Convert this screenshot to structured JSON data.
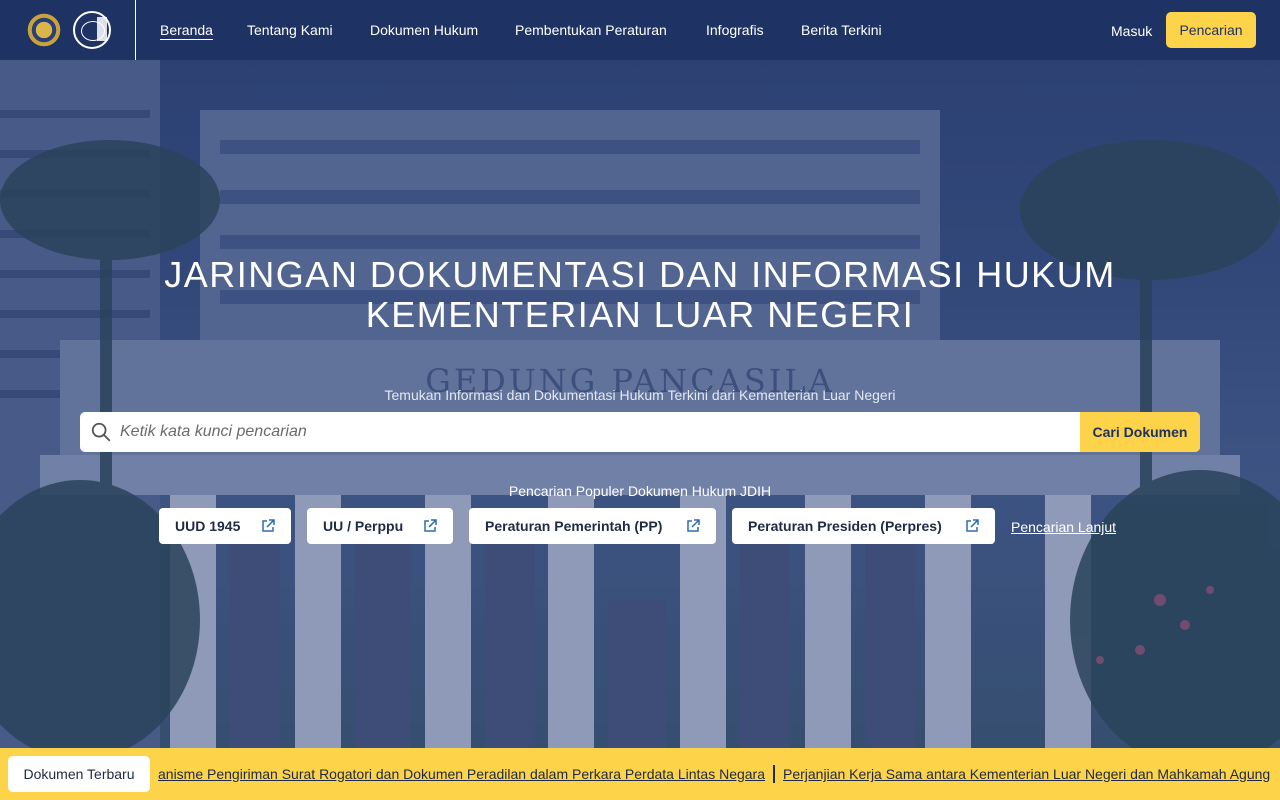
{
  "header": {
    "nav": [
      "Beranda",
      "Tentang Kami",
      "Dokumen Hukum",
      "Pembentukan Peraturan",
      "Infografis",
      "Berita Terkini"
    ],
    "active_nav": "Beranda",
    "login_label": "Masuk",
    "search_button_label": "Pencarian"
  },
  "hero": {
    "title_line1": "JARINGAN DOKUMENTASI DAN INFORMASI HUKUM",
    "title_line2": "KEMENTERIAN LUAR NEGERI",
    "subtitle": "Temukan Informasi dan Dokumentasi Hukum Terkini dari Kementerian Luar Negeri",
    "building_text": "GEDUNG PANCASILA"
  },
  "search": {
    "placeholder": "Ketik kata kunci pencarian",
    "value": "",
    "button_label": "Cari Dokumen"
  },
  "popular": {
    "label": "Pencarian Populer Dokumen Hukum JDIH",
    "items": [
      "UUD 1945",
      "UU / Perppu",
      "Peraturan Pemerintah (PP)",
      "Peraturan Presiden (Perpres)"
    ],
    "advanced_link": "Pencarian Lanjut"
  },
  "ticker": {
    "badge": "Dokumen Terbaru",
    "items": [
      "anisme Pengiriman Surat Rogatori dan Dokumen Peradilan dalam Perkara Perdata Lintas Negara",
      "Perjanjian Kerja Sama antara Kementerian Luar Negeri dan Mahkamah Agung"
    ]
  },
  "colors": {
    "navy": "#1e3264",
    "accent_yellow": "#fdd34a",
    "white": "#ffffff"
  },
  "icons": [
    "search-icon",
    "external-link-icon",
    "kemlu-emblem-logo",
    "jdih-logo"
  ]
}
